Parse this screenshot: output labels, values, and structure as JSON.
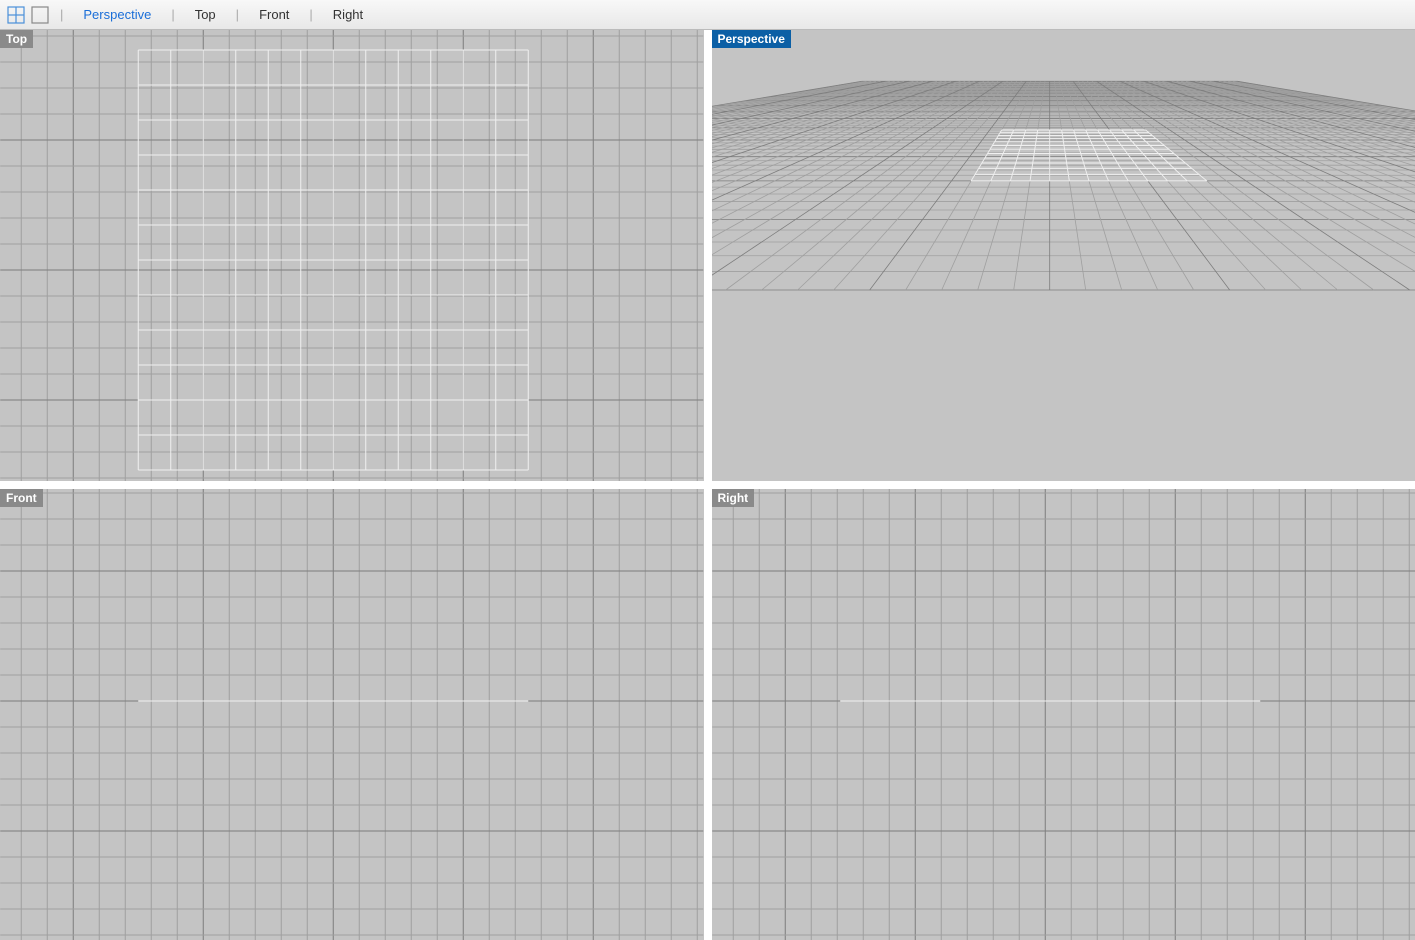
{
  "toolbar": {
    "tabs": [
      {
        "label": "Perspective",
        "active": true
      },
      {
        "label": "Top",
        "active": false
      },
      {
        "label": "Front",
        "active": false
      },
      {
        "label": "Right",
        "active": false
      }
    ]
  },
  "viewports": {
    "top_left": {
      "label": "Top",
      "active": false
    },
    "top_right": {
      "label": "Perspective",
      "active": true
    },
    "bottom_left": {
      "label": "Front",
      "active": false
    },
    "bottom_right": {
      "label": "Right",
      "active": false
    }
  },
  "colors": {
    "grid_bg": "#c4c4c4",
    "grid_line_minor": "#9f9f9f",
    "grid_line_major": "#7d7d7d",
    "mesh_line": "#f0f0f0",
    "accent": "#1a6ed8"
  }
}
